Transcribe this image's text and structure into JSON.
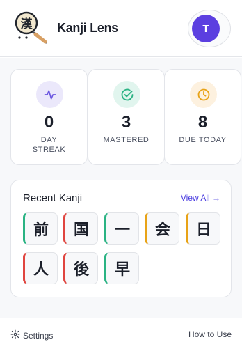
{
  "app": {
    "name": "Kanji Lens",
    "logo_glyph": "漢"
  },
  "user": {
    "initial": "T",
    "avatar_color": "#5b3fe0"
  },
  "stats": {
    "streak": {
      "value": "0",
      "label_line1": "DAY",
      "label_line2": "STREAK",
      "icon": "activity-icon",
      "color": "#6a55e0"
    },
    "mastered": {
      "value": "3",
      "label": "MASTERED",
      "icon": "check-circle-icon",
      "color": "#2ab383"
    },
    "due": {
      "value": "8",
      "label": "DUE TODAY",
      "icon": "clock-icon",
      "color": "#e8a317"
    }
  },
  "recent": {
    "title": "Recent Kanji",
    "view_all": "View All →",
    "items": [
      {
        "char": "前",
        "status": "green"
      },
      {
        "char": "国",
        "status": "red"
      },
      {
        "char": "一",
        "status": "green"
      },
      {
        "char": "会",
        "status": "orange"
      },
      {
        "char": "日",
        "status": "orange"
      },
      {
        "char": "人",
        "status": "red"
      },
      {
        "char": "後",
        "status": "red"
      },
      {
        "char": "早",
        "status": "green"
      }
    ]
  },
  "footer": {
    "settings_label": "Settings",
    "settings_icon": "gear-icon",
    "howto_label": "How to Use"
  }
}
